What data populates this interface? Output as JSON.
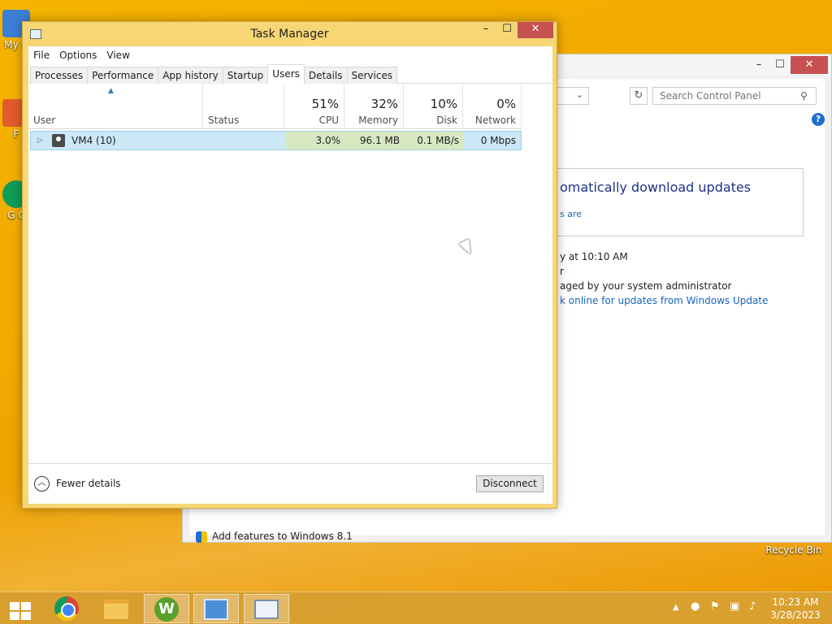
{
  "desktop": {
    "icons": [
      {
        "label": "My C"
      },
      {
        "label": "F"
      },
      {
        "label": "G C"
      },
      {
        "label": "Recycle Bin"
      }
    ]
  },
  "control_panel": {
    "search_placeholder": "Search Control Panel",
    "help_label": "?",
    "heading": "omatically download updates",
    "link_partial": "s are",
    "text_lines": [
      "y at 10:10 AM",
      "r",
      "aged by your system administrator"
    ],
    "check_link": "k online for updates from Windows Update",
    "add_features": "Add features to Windows 8.1",
    "window_controls": {
      "minimize": "–",
      "maximize": "☐",
      "close": "✕"
    }
  },
  "task_manager": {
    "title": "Task Manager",
    "window_controls": {
      "minimize": "–",
      "maximize": "☐",
      "close": "✕"
    },
    "menu": [
      "File",
      "Options",
      "View"
    ],
    "tabs": [
      {
        "label": "Processes",
        "active": false
      },
      {
        "label": "Performance",
        "active": false
      },
      {
        "label": "App history",
        "active": false
      },
      {
        "label": "Startup",
        "active": false
      },
      {
        "label": "Users",
        "active": true
      },
      {
        "label": "Details",
        "active": false
      },
      {
        "label": "Services",
        "active": false
      }
    ],
    "columns": {
      "user": "User",
      "status": "Status",
      "cpu": {
        "pct": "51%",
        "label": "CPU"
      },
      "memory": {
        "pct": "32%",
        "label": "Memory"
      },
      "disk": {
        "pct": "10%",
        "label": "Disk"
      },
      "network": {
        "pct": "0%",
        "label": "Network"
      }
    },
    "rows": [
      {
        "user": "VM4 (10)",
        "status": "",
        "cpu": "3.0%",
        "memory": "96.1 MB",
        "disk": "0.1 MB/s",
        "network": "0 Mbps"
      }
    ],
    "footer": {
      "fewer_details": "Fewer details",
      "disconnect": "Disconnect"
    }
  },
  "taskbar": {
    "time": "10:23 AM",
    "date": "3/28/2023",
    "tray_icons": [
      "show-hidden-icons",
      "network-status-icon",
      "action-center-flag-icon",
      "network-icon",
      "speaker-muted-icon"
    ]
  },
  "colors": {
    "desktop": "#f2a900",
    "tm_frame": "#f6d675",
    "selection": "#cce8f6",
    "heat": "#d7e8c1",
    "close": "#c75050",
    "link": "#1565c0"
  }
}
